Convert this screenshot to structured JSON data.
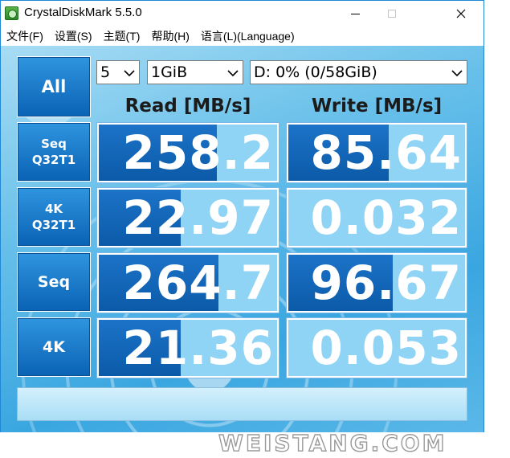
{
  "window": {
    "title": "CrystalDiskMark 5.5.0"
  },
  "menu": {
    "items": [
      "文件(F)",
      "设置(S)",
      "主题(T)",
      "帮助(H)",
      "语言(L)(Language)"
    ]
  },
  "controls": {
    "all_label": "All",
    "count_value": "5",
    "size_value": "1GiB",
    "drive_value": "D: 0% (0/58GiB)"
  },
  "headers": {
    "read": "Read [MB/s]",
    "write": "Write [MB/s]"
  },
  "tests": [
    {
      "label_line1": "Seq",
      "label_line2": "Q32T1",
      "read": "258.2",
      "write": "85.64",
      "read_bar": 0.66,
      "write_bar": 0.57
    },
    {
      "label_line1": "4K",
      "label_line2": "Q32T1",
      "read": "22.97",
      "write": "0.032",
      "read_bar": 0.46,
      "write_bar": 0.0
    },
    {
      "label_line1": "Seq",
      "label_line2": "",
      "read": "264.7",
      "write": "96.67",
      "read_bar": 0.67,
      "write_bar": 0.59
    },
    {
      "label_line1": "4K",
      "label_line2": "",
      "read": "21.36",
      "write": "0.053",
      "read_bar": 0.46,
      "write_bar": 0.0
    }
  ],
  "status": {
    "text": ""
  },
  "watermark": "WEISTANG.COM",
  "colors": {
    "accent": "#1e87d6",
    "button": "#0a62b5",
    "bar_fill": "#0b5aa8",
    "bar_light": "#8fd3f5"
  }
}
